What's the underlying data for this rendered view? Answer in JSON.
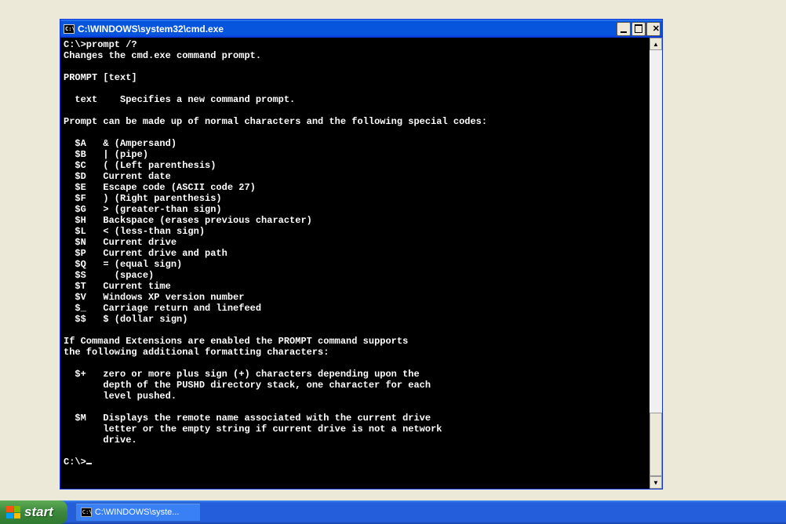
{
  "window": {
    "title": "C:\\WINDOWS\\system32\\cmd.exe",
    "icon_label": "C:\\"
  },
  "terminal": {
    "lines": [
      "C:\\>prompt /?",
      "Changes the cmd.exe command prompt.",
      "",
      "PROMPT [text]",
      "",
      "  text    Specifies a new command prompt.",
      "",
      "Prompt can be made up of normal characters and the following special codes:",
      "",
      "  $A   & (Ampersand)",
      "  $B   | (pipe)",
      "  $C   ( (Left parenthesis)",
      "  $D   Current date",
      "  $E   Escape code (ASCII code 27)",
      "  $F   ) (Right parenthesis)",
      "  $G   > (greater-than sign)",
      "  $H   Backspace (erases previous character)",
      "  $L   < (less-than sign)",
      "  $N   Current drive",
      "  $P   Current drive and path",
      "  $Q   = (equal sign)",
      "  $S     (space)",
      "  $T   Current time",
      "  $V   Windows XP version number",
      "  $_   Carriage return and linefeed",
      "  $$   $ (dollar sign)",
      "",
      "If Command Extensions are enabled the PROMPT command supports",
      "the following additional formatting characters:",
      "",
      "  $+   zero or more plus sign (+) characters depending upon the",
      "       depth of the PUSHD directory stack, one character for each",
      "       level pushed.",
      "",
      "  $M   Displays the remote name associated with the current drive",
      "       letter or the empty string if current drive is not a network",
      "       drive.",
      "",
      "C:\\>"
    ]
  },
  "taskbar": {
    "start_label": "start",
    "task_icon_label": "C:\\",
    "task_label": "C:\\WINDOWS\\syste..."
  }
}
